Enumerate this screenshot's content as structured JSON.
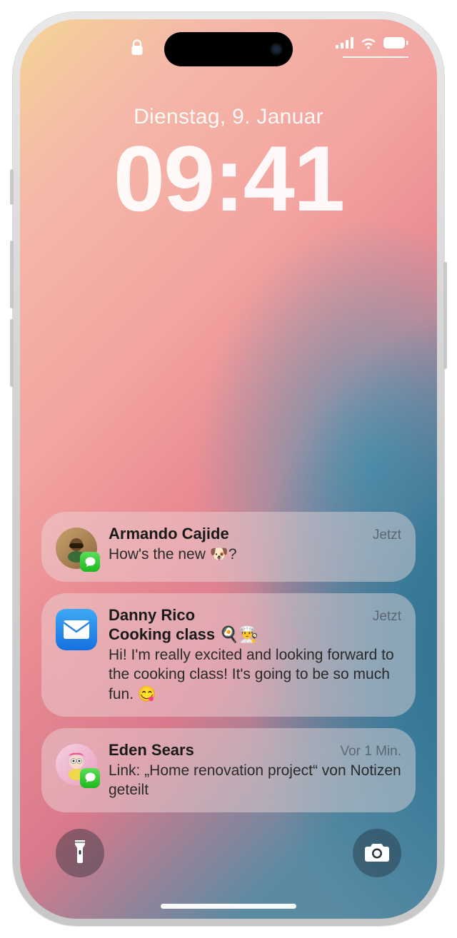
{
  "status": {
    "lock": "locked"
  },
  "date": "Dienstag, 9. Januar",
  "time": "09:41",
  "notifications": [
    {
      "sender": "Armando Cajide",
      "time": "Jetzt",
      "body": "How's the new 🐶?",
      "app": "messages",
      "avatar": "memoji-sunglasses"
    },
    {
      "sender": "Danny Rico",
      "subject": "Cooking class 🍳👨‍🍳",
      "time": "Jetzt",
      "body": "Hi! I'm really excited and looking forward to the cooking class! It's going to be so much fun. 😋",
      "app": "mail"
    },
    {
      "sender": "Eden Sears",
      "time": "Vor 1 Min.",
      "body": "Link: „Home renovation project“ von Notizen geteilt",
      "app": "messages",
      "avatar": "memoji-pink"
    }
  ],
  "controls": {
    "flashlight": "Taschenlampe",
    "camera": "Kamera"
  }
}
